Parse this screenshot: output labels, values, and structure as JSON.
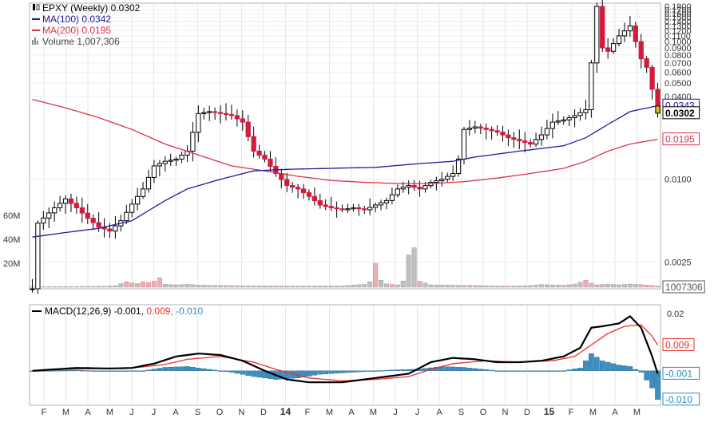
{
  "chart_data": [
    {
      "type": "line",
      "subtype": "candlestick-with-moving-averages-and-volume",
      "title": "EPXY (Weekly)",
      "last_value": 0.0302,
      "legend": [
        {
          "label": "EPXY (Weekly)",
          "value": "0.0302",
          "color": "#000000",
          "icon": "candlestick-icon"
        },
        {
          "label": "MA(100)",
          "value": "0.0342",
          "color": "#1a1a9c",
          "icon": "line-icon"
        },
        {
          "label": "MA(200)",
          "value": "0.0195",
          "color": "#e0304a",
          "icon": "line-icon"
        },
        {
          "label": "Volume",
          "value": "1,007,306",
          "color": "#999999",
          "icon": "volume-icon"
        }
      ],
      "y_scale": "log",
      "ylim": [
        0.0016,
        0.19
      ],
      "y_ticks": [
        "0.1800",
        "0.1700",
        "0.1600",
        "0.1500",
        "0.1400",
        "0.1300",
        "0.1200",
        "0.1100",
        "0.1000",
        "0.0900",
        "0.0800",
        "0.0700",
        "0.0600",
        "0.0500",
        "0.0400",
        "0.0343",
        "0.0302",
        "0.0195",
        "0.0100",
        "0.0025",
        "1007306"
      ],
      "y_ticks_plain": [
        0.18,
        0.17,
        0.16,
        0.15,
        0.14,
        0.13,
        0.12,
        0.11,
        0.1,
        0.09,
        0.08,
        0.07,
        0.06,
        0.05,
        0.04,
        0.01,
        0.0025
      ],
      "y_labels_boxed": [
        {
          "text": "0.0343",
          "color": "#1a1a9c",
          "value": 0.0343
        },
        {
          "text": "0.0302",
          "color": "#000000",
          "value": 0.0302,
          "bold": true
        },
        {
          "text": "0.0195",
          "color": "#e0304a",
          "value": 0.0195
        },
        {
          "text": "1007306",
          "color": "#555555",
          "volume_tag": true
        }
      ],
      "volume_axis_ticks": [
        "60M",
        "40M",
        "20M"
      ],
      "volume_axis_values": [
        60000000,
        40000000,
        20000000
      ],
      "x_tick_labels": [
        "F",
        "M",
        "A",
        "M",
        "J",
        "J",
        "A",
        "S",
        "O",
        "N",
        "D",
        "14",
        "F",
        "M",
        "A",
        "M",
        "J",
        "J",
        "A",
        "S",
        "O",
        "N",
        "D",
        "15",
        "F",
        "M",
        "A",
        "M"
      ],
      "x_tick_bold": [
        "14",
        "15"
      ],
      "weeks": 114,
      "price_anchors": [
        [
          0,
          0.0016
        ],
        [
          1,
          0.0048
        ],
        [
          4,
          0.0062
        ],
        [
          6,
          0.0072
        ],
        [
          8,
          0.0062
        ],
        [
          10,
          0.0052
        ],
        [
          12,
          0.0045
        ],
        [
          14,
          0.0042
        ],
        [
          16,
          0.005
        ],
        [
          18,
          0.0066
        ],
        [
          20,
          0.0085
        ],
        [
          22,
          0.0125
        ],
        [
          24,
          0.0135
        ],
        [
          26,
          0.014
        ],
        [
          28,
          0.016
        ],
        [
          30,
          0.03
        ],
        [
          32,
          0.031
        ],
        [
          34,
          0.03
        ],
        [
          36,
          0.029
        ],
        [
          38,
          0.026
        ],
        [
          40,
          0.016
        ],
        [
          42,
          0.014
        ],
        [
          44,
          0.011
        ],
        [
          46,
          0.009
        ],
        [
          48,
          0.0085
        ],
        [
          50,
          0.0075
        ],
        [
          52,
          0.0065
        ],
        [
          54,
          0.0062
        ],
        [
          56,
          0.006
        ],
        [
          58,
          0.0062
        ],
        [
          60,
          0.006
        ],
        [
          62,
          0.0065
        ],
        [
          64,
          0.007
        ],
        [
          66,
          0.0085
        ],
        [
          68,
          0.009
        ],
        [
          70,
          0.0085
        ],
        [
          72,
          0.0095
        ],
        [
          74,
          0.01
        ],
        [
          76,
          0.011
        ],
        [
          77,
          0.014
        ],
        [
          78,
          0.023
        ],
        [
          80,
          0.024
        ],
        [
          82,
          0.023
        ],
        [
          84,
          0.022
        ],
        [
          86,
          0.02
        ],
        [
          88,
          0.019
        ],
        [
          90,
          0.018
        ],
        [
          92,
          0.021
        ],
        [
          94,
          0.026
        ],
        [
          96,
          0.027
        ],
        [
          98,
          0.029
        ],
        [
          100,
          0.032
        ],
        [
          101,
          0.07
        ],
        [
          102,
          0.18
        ],
        [
          103,
          0.09
        ],
        [
          104,
          0.085
        ],
        [
          106,
          0.11
        ],
        [
          108,
          0.13
        ],
        [
          109,
          0.1
        ],
        [
          110,
          0.075
        ],
        [
          111,
          0.065
        ],
        [
          112,
          0.045
        ],
        [
          113,
          0.0302
        ]
      ],
      "ma100_anchors": [
        [
          0,
          0.0038
        ],
        [
          6,
          0.0041
        ],
        [
          12,
          0.0044
        ],
        [
          18,
          0.005
        ],
        [
          24,
          0.007
        ],
        [
          28,
          0.0085
        ],
        [
          34,
          0.01
        ],
        [
          40,
          0.0115
        ],
        [
          46,
          0.0118
        ],
        [
          54,
          0.012
        ],
        [
          62,
          0.0122
        ],
        [
          70,
          0.013
        ],
        [
          76,
          0.0135
        ],
        [
          80,
          0.0145
        ],
        [
          88,
          0.016
        ],
        [
          96,
          0.0175
        ],
        [
          100,
          0.02
        ],
        [
          104,
          0.025
        ],
        [
          108,
          0.031
        ],
        [
          113,
          0.0342
        ]
      ],
      "ma200_anchors": [
        [
          0,
          0.038
        ],
        [
          6,
          0.033
        ],
        [
          12,
          0.028
        ],
        [
          18,
          0.023
        ],
        [
          24,
          0.018
        ],
        [
          30,
          0.015
        ],
        [
          36,
          0.0125
        ],
        [
          42,
          0.0115
        ],
        [
          48,
          0.0105
        ],
        [
          54,
          0.0098
        ],
        [
          60,
          0.0095
        ],
        [
          66,
          0.0093
        ],
        [
          72,
          0.0093
        ],
        [
          78,
          0.0096
        ],
        [
          84,
          0.0102
        ],
        [
          90,
          0.011
        ],
        [
          96,
          0.012
        ],
        [
          100,
          0.0135
        ],
        [
          104,
          0.016
        ],
        [
          108,
          0.018
        ],
        [
          113,
          0.0195
        ]
      ],
      "volume_anchors": [
        [
          0,
          0.4
        ],
        [
          13,
          0.8
        ],
        [
          15,
          1.3
        ],
        [
          16,
          3.0
        ],
        [
          17,
          4.5
        ],
        [
          18,
          3.6
        ],
        [
          19,
          3.0
        ],
        [
          20,
          4.5
        ],
        [
          21,
          4.0
        ],
        [
          22,
          5.0
        ],
        [
          23,
          7.8
        ],
        [
          24,
          2.5
        ],
        [
          26,
          2.0
        ],
        [
          28,
          2.4
        ],
        [
          30,
          1.8
        ],
        [
          34,
          1.4
        ],
        [
          40,
          1.2
        ],
        [
          50,
          1.0
        ],
        [
          56,
          1.2
        ],
        [
          60,
          2.4
        ],
        [
          61,
          4.5
        ],
        [
          62,
          20.0
        ],
        [
          63,
          5.8
        ],
        [
          64,
          2.8
        ],
        [
          65,
          2.4
        ],
        [
          66,
          2.0
        ],
        [
          67,
          5.2
        ],
        [
          68,
          27.0
        ],
        [
          69,
          33.0
        ],
        [
          70,
          5.0
        ],
        [
          72,
          2.0
        ],
        [
          80,
          1.4
        ],
        [
          86,
          1.0
        ],
        [
          90,
          1.4
        ],
        [
          92,
          2.2
        ],
        [
          96,
          1.6
        ],
        [
          98,
          2.6
        ],
        [
          100,
          5.8
        ],
        [
          101,
          3.4
        ],
        [
          102,
          2.0
        ],
        [
          104,
          2.6
        ],
        [
          106,
          2.0
        ],
        [
          108,
          2.6
        ],
        [
          110,
          2.2
        ],
        [
          112,
          1.4
        ],
        [
          113,
          1.0
        ]
      ],
      "volume_red_weeks": [
        17,
        18,
        20,
        21,
        22,
        23,
        36,
        44,
        62,
        65,
        70,
        80,
        86,
        96,
        100,
        102,
        110,
        111,
        112
      ]
    },
    {
      "type": "line",
      "title": "MACD(12,26,9)",
      "legend": [
        {
          "label": "MACD(12,26,9)",
          "value": "-0.001",
          "color": "#000000"
        },
        {
          "label": "",
          "value": "0.009",
          "color": "#e8302a"
        },
        {
          "label": "",
          "value": "-0.010",
          "color": "#2a8bbf"
        }
      ],
      "ylim": [
        -0.012,
        0.023
      ],
      "y_ticks": [
        "0.02"
      ],
      "y_tick_values": [
        0.02
      ],
      "y_labels_boxed": [
        {
          "text": "0.009",
          "color": "#e8302a",
          "value": 0.009
        },
        {
          "text": "-0.001",
          "color": "#2a8bbf",
          "value": -0.001
        },
        {
          "text": "-0.010",
          "color": "#2a8bbf",
          "value": -0.01
        }
      ],
      "x_tick_labels": [
        "F",
        "M",
        "A",
        "M",
        "J",
        "J",
        "A",
        "S",
        "O",
        "N",
        "D",
        "14",
        "F",
        "M",
        "A",
        "M",
        "J",
        "J",
        "A",
        "S",
        "O",
        "N",
        "D",
        "15",
        "F",
        "M",
        "A",
        "M"
      ],
      "macd_anchors": [
        [
          0,
          0.0
        ],
        [
          4,
          0.0005
        ],
        [
          8,
          0.001
        ],
        [
          14,
          0.0008
        ],
        [
          18,
          0.001
        ],
        [
          22,
          0.0025
        ],
        [
          26,
          0.005
        ],
        [
          30,
          0.006
        ],
        [
          34,
          0.0055
        ],
        [
          38,
          0.0035
        ],
        [
          42,
          0.0
        ],
        [
          46,
          -0.003
        ],
        [
          50,
          -0.004
        ],
        [
          56,
          -0.004
        ],
        [
          60,
          -0.003
        ],
        [
          64,
          -0.002
        ],
        [
          68,
          -0.001
        ],
        [
          72,
          0.003
        ],
        [
          76,
          0.0045
        ],
        [
          80,
          0.004
        ],
        [
          84,
          0.003
        ],
        [
          88,
          0.003
        ],
        [
          92,
          0.0035
        ],
        [
          96,
          0.005
        ],
        [
          99,
          0.008
        ],
        [
          101,
          0.015
        ],
        [
          103,
          0.0155
        ],
        [
          106,
          0.0165
        ],
        [
          108,
          0.019
        ],
        [
          110,
          0.015
        ],
        [
          112,
          0.005
        ],
        [
          113,
          -0.001
        ]
      ],
      "signal_anchors": [
        [
          0,
          0.0
        ],
        [
          6,
          0.0005
        ],
        [
          12,
          0.0008
        ],
        [
          18,
          0.001
        ],
        [
          24,
          0.0022
        ],
        [
          28,
          0.004
        ],
        [
          34,
          0.005
        ],
        [
          40,
          0.003
        ],
        [
          44,
          0.0005
        ],
        [
          50,
          -0.0025
        ],
        [
          56,
          -0.0035
        ],
        [
          62,
          -0.003
        ],
        [
          68,
          -0.002
        ],
        [
          72,
          0.0005
        ],
        [
          76,
          0.0025
        ],
        [
          82,
          0.0035
        ],
        [
          88,
          0.003
        ],
        [
          94,
          0.0035
        ],
        [
          98,
          0.005
        ],
        [
          101,
          0.009
        ],
        [
          104,
          0.013
        ],
        [
          107,
          0.0155
        ],
        [
          110,
          0.016
        ],
        [
          112,
          0.012
        ],
        [
          113,
          0.009
        ]
      ],
      "histogram_anchors": [
        [
          0,
          0.0
        ],
        [
          8,
          0.0002
        ],
        [
          14,
          -0.0002
        ],
        [
          20,
          0.0
        ],
        [
          24,
          0.0012
        ],
        [
          28,
          0.0015
        ],
        [
          32,
          0.0005
        ],
        [
          36,
          -0.0005
        ],
        [
          40,
          -0.002
        ],
        [
          44,
          -0.003
        ],
        [
          48,
          -0.0025
        ],
        [
          52,
          -0.0012
        ],
        [
          58,
          -0.0005
        ],
        [
          64,
          0.0002
        ],
        [
          70,
          0.0006
        ],
        [
          74,
          0.0015
        ],
        [
          78,
          0.0012
        ],
        [
          84,
          0.0
        ],
        [
          90,
          -0.0002
        ],
        [
          96,
          0.0
        ],
        [
          99,
          0.001
        ],
        [
          101,
          0.006
        ],
        [
          103,
          0.0035
        ],
        [
          106,
          0.002
        ],
        [
          108,
          0.0015
        ],
        [
          110,
          -0.0005
        ],
        [
          112,
          -0.006
        ],
        [
          113,
          -0.01
        ]
      ]
    }
  ]
}
